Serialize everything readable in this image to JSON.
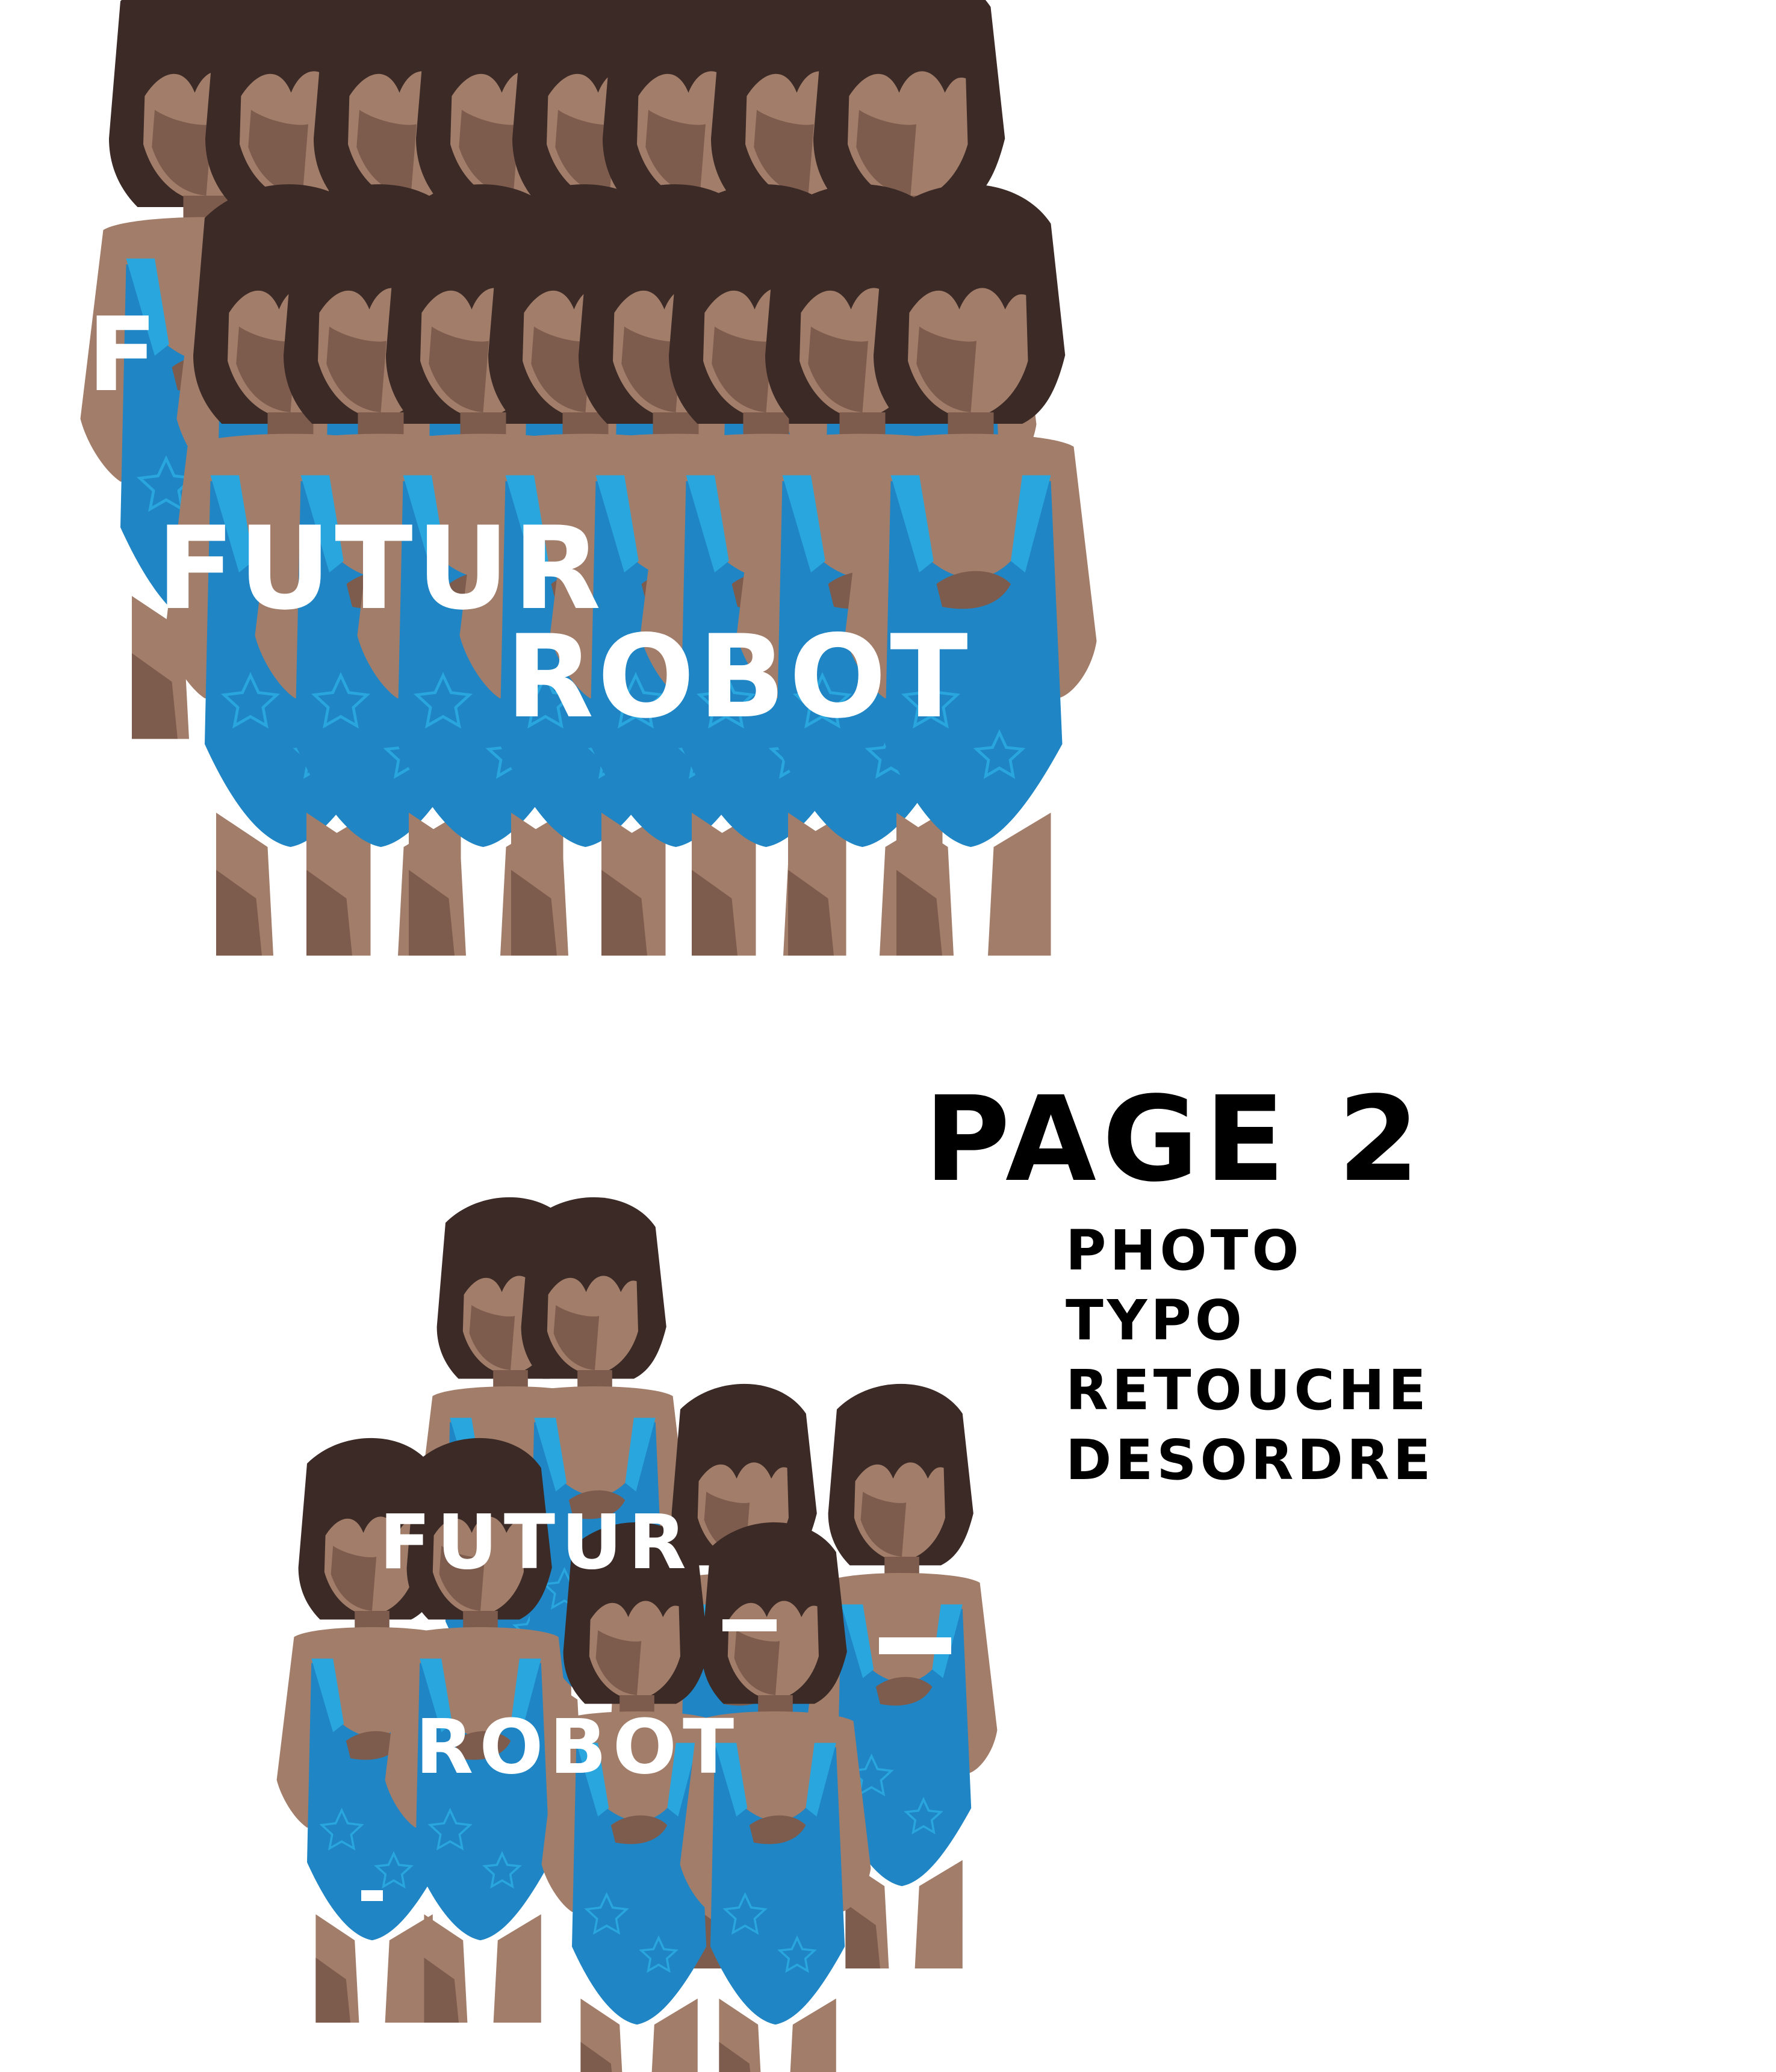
{
  "colors": {
    "background": "#ffffff",
    "hair": "#3b2a26",
    "skin": "#a27d6a",
    "skin_shadow": "#7d5c4e",
    "swimsuit": "#1f85c4",
    "swimsuit_light": "#2aa6de",
    "overlay_text": "#ffffff",
    "heading_text": "#000000"
  },
  "collage_top": {
    "image": "repeated-girl-figures-top",
    "words": {
      "f": "F",
      "futur": "FUTUR",
      "robot": "ROBOT"
    }
  },
  "collage_bottom": {
    "image": "repeated-girl-figures-bottom",
    "words": {
      "futur": "FUTUR",
      "robot": "ROBOT"
    }
  },
  "page": {
    "heading": "PAGE 2",
    "topics": [
      "PHOTO",
      "TYPO",
      "RETOUCHE",
      "DESORDRE"
    ]
  }
}
